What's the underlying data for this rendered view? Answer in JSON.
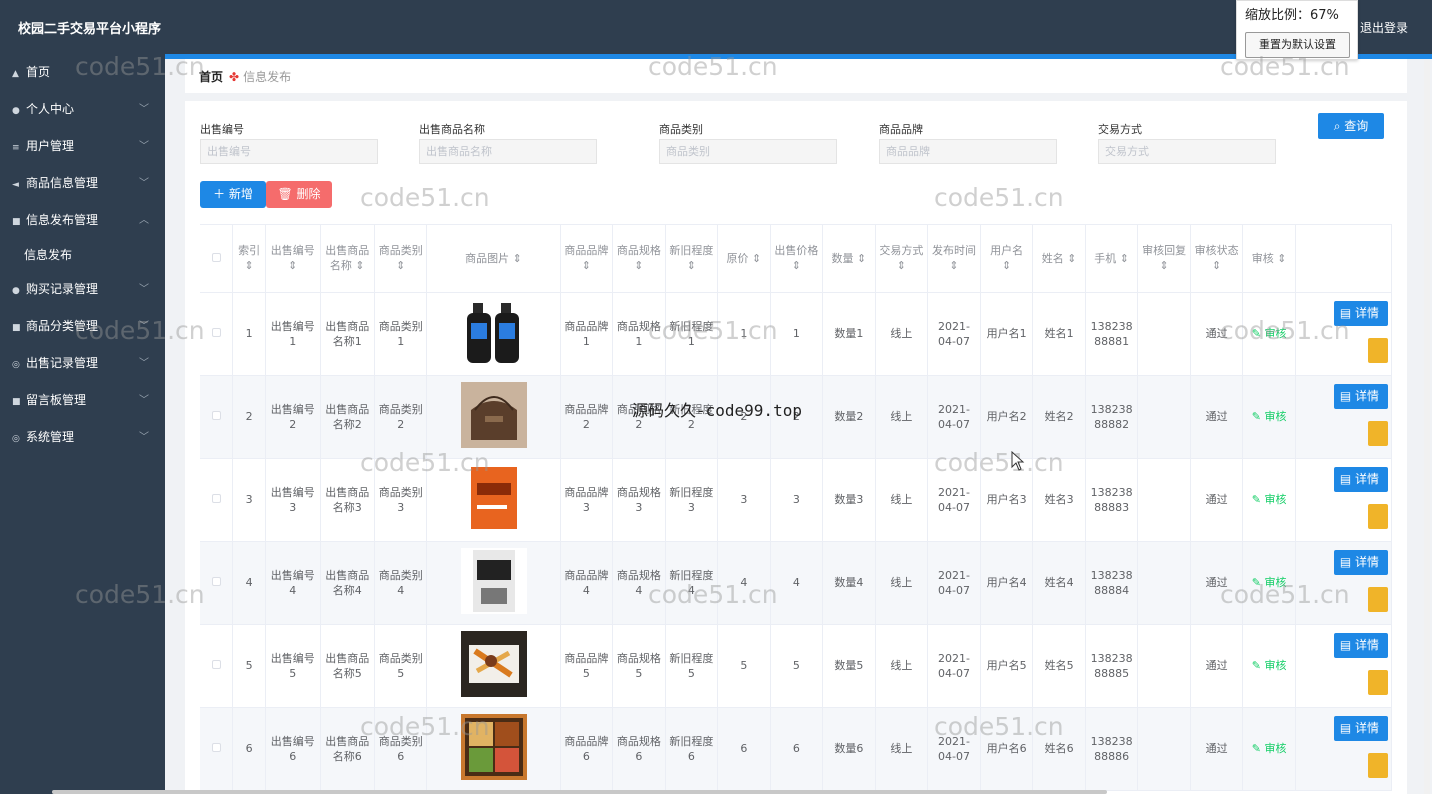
{
  "app": {
    "title": "校园二手交易平台小程序",
    "logout": "退出登录"
  },
  "zoom": {
    "label": "缩放比例：67%",
    "reset": "重置为默认设置"
  },
  "sidebar": {
    "items": [
      {
        "icon": "▲",
        "label": "首页",
        "chev": ""
      },
      {
        "icon": "●",
        "label": "个人中心",
        "chev": "﹀"
      },
      {
        "icon": "≡",
        "label": "用户管理",
        "chev": "﹀"
      },
      {
        "icon": "◄",
        "label": "商品信息管理",
        "chev": "﹀"
      },
      {
        "icon": "■",
        "label": "信息发布管理",
        "chev": "︿"
      },
      {
        "sub": true,
        "label": "信息发布"
      },
      {
        "icon": "●",
        "label": "购买记录管理",
        "chev": "﹀"
      },
      {
        "icon": "■",
        "label": "商品分类管理",
        "chev": "﹀"
      },
      {
        "icon": "◎",
        "label": "出售记录管理",
        "chev": "﹀"
      },
      {
        "icon": "■",
        "label": "留言板管理",
        "chev": "﹀"
      },
      {
        "icon": "◎",
        "label": "系统管理",
        "chev": "﹀"
      }
    ]
  },
  "breadcrumb": {
    "home": "首页",
    "icon": "✤",
    "current": "信息发布"
  },
  "search": {
    "fields": [
      {
        "label": "出售编号",
        "placeholder": "出售编号"
      },
      {
        "label": "出售商品名称",
        "placeholder": "出售商品名称"
      },
      {
        "label": "商品类别",
        "placeholder": "商品类别"
      },
      {
        "label": "商品品牌",
        "placeholder": "商品品牌"
      },
      {
        "label": "交易方式",
        "placeholder": "交易方式"
      }
    ],
    "query": "查询"
  },
  "actions": {
    "add": "＋ 新增",
    "delete": "删除"
  },
  "table": {
    "headers": [
      "索引",
      "出售编号",
      "出售商品名称",
      "商品类别",
      "商品图片",
      "商品品牌",
      "商品规格",
      "新旧程度",
      "原价",
      "出售价格",
      "数量",
      "交易方式",
      "发布时间",
      "用户名",
      "姓名",
      "手机",
      "审核回复",
      "审核状态",
      "审核"
    ],
    "audit_label": "审核",
    "detail_label": "详情",
    "rows": [
      {
        "index": "1",
        "no": "出售编号1",
        "name": "出售商品名称1",
        "cat": "商品类别1",
        "img": "bottles",
        "brand": "商品品牌1",
        "spec": "商品规格1",
        "cond": "新旧程度1",
        "orig": "1",
        "price": "1",
        "qty": "数量1",
        "trade": "线上",
        "time": "2021-04-07",
        "user": "用户名1",
        "realname": "姓名1",
        "phone": "13823888881",
        "reply": "",
        "status": "通过"
      },
      {
        "index": "2",
        "no": "出售编号2",
        "name": "出售商品名称2",
        "cat": "商品类别2",
        "img": "bag",
        "brand": "商品品牌2",
        "spec": "商品规格2",
        "cond": "新旧程度2",
        "orig": "2",
        "price": "2",
        "qty": "数量2",
        "trade": "线上",
        "time": "2021-04-07",
        "user": "用户名2",
        "realname": "姓名2",
        "phone": "13823888882",
        "reply": "",
        "status": "通过"
      },
      {
        "index": "3",
        "no": "出售编号3",
        "name": "出售商品名称3",
        "cat": "商品类别3",
        "img": "book-orange",
        "brand": "商品品牌3",
        "spec": "商品规格3",
        "cond": "新旧程度3",
        "orig": "3",
        "price": "3",
        "qty": "数量3",
        "trade": "线上",
        "time": "2021-04-07",
        "user": "用户名3",
        "realname": "姓名3",
        "phone": "13823888883",
        "reply": "",
        "status": "通过"
      },
      {
        "index": "4",
        "no": "出售编号4",
        "name": "出售商品名称4",
        "cat": "商品类别4",
        "img": "book-gray",
        "brand": "商品品牌4",
        "spec": "商品规格4",
        "cond": "新旧程度4",
        "orig": "4",
        "price": "4",
        "qty": "数量4",
        "trade": "线上",
        "time": "2021-04-07",
        "user": "用户名4",
        "realname": "姓名4",
        "phone": "13823888884",
        "reply": "",
        "status": "通过"
      },
      {
        "index": "5",
        "no": "出售编号5",
        "name": "出售商品名称5",
        "cat": "商品类别5",
        "img": "food-box",
        "brand": "商品品牌5",
        "spec": "商品规格5",
        "cond": "新旧程度5",
        "orig": "5",
        "price": "5",
        "qty": "数量5",
        "trade": "线上",
        "time": "2021-04-07",
        "user": "用户名5",
        "realname": "姓名5",
        "phone": "13823888885",
        "reply": "",
        "status": "通过"
      },
      {
        "index": "6",
        "no": "出售编号6",
        "name": "出售商品名称6",
        "cat": "商品类别6",
        "img": "bento",
        "brand": "商品品牌6",
        "spec": "商品规格6",
        "cond": "新旧程度6",
        "orig": "6",
        "price": "6",
        "qty": "数量6",
        "trade": "线上",
        "time": "2021-04-07",
        "user": "用户名6",
        "realname": "姓名6",
        "phone": "13823888886",
        "reply": "",
        "status": "通过"
      }
    ]
  },
  "watermarks": {
    "site": "code51.cn",
    "overlay": "源码久久-code99.top"
  },
  "colors": {
    "primary": "#1e88e5",
    "danger": "#f56c6c",
    "sidebar": "#2f3e4f",
    "success": "#13ce66",
    "warning": "#f0b429"
  }
}
